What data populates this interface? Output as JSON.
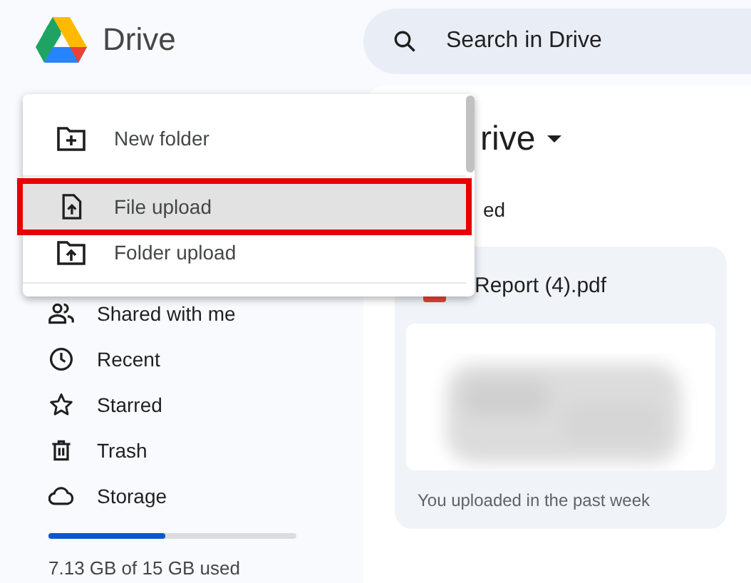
{
  "app": {
    "title": "Drive"
  },
  "search": {
    "placeholder": "Search in Drive"
  },
  "menu": [
    {
      "label": "New folder",
      "selected": false,
      "outlined": false
    },
    {
      "label": "File upload",
      "selected": true,
      "outlined": true
    },
    {
      "label": "Folder upload",
      "selected": false,
      "outlined": false
    }
  ],
  "sidebar": {
    "items": [
      {
        "label": "Shared with me"
      },
      {
        "label": "Recent"
      },
      {
        "label": "Starred"
      },
      {
        "label": "Trash"
      },
      {
        "label": "Storage"
      }
    ]
  },
  "storage": {
    "level": 0.47,
    "text": "7.13 GB of 15 GB used"
  },
  "main": {
    "title": "rive",
    "subtitle": "ed",
    "card": {
      "name": "Report (4).pdf",
      "note": "You uploaded in the past week"
    }
  }
}
